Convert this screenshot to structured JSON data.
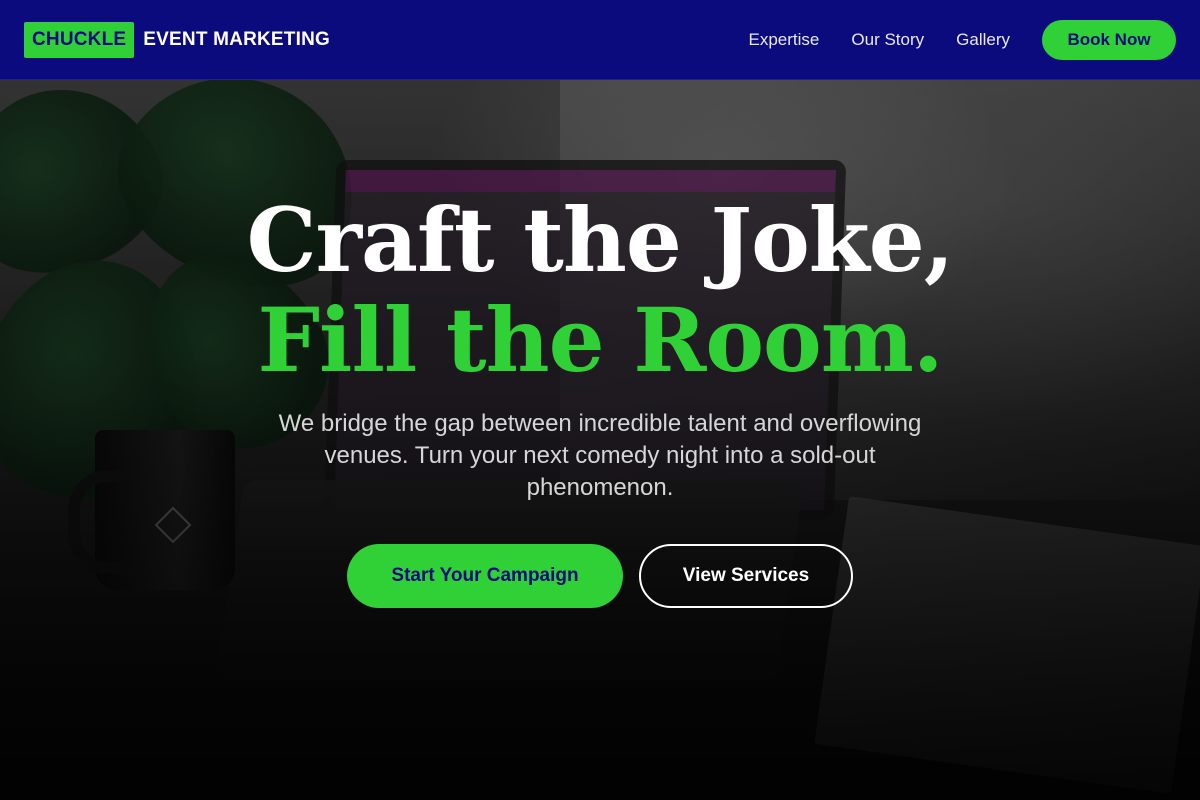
{
  "brand": {
    "badge_text": "CHUCKLE",
    "name_text": "EVENT MARKETING"
  },
  "nav": {
    "links": [
      {
        "label": "Expertise"
      },
      {
        "label": "Our Story"
      },
      {
        "label": "Gallery"
      }
    ],
    "cta_label": "Book Now"
  },
  "hero": {
    "headline_line1": "Craft the Joke,",
    "headline_line2": "Fill the Room.",
    "subtitle": "We bridge the gap between incredible talent and overflowing venues. Turn your next comedy night into a sold-out phenomenon.",
    "primary_cta": "Start Your Campaign",
    "secondary_cta": "View Services"
  },
  "colors": {
    "nav_background": "#0b0b7d",
    "accent_green": "#2fd136",
    "headline_white": "#ffffff"
  }
}
